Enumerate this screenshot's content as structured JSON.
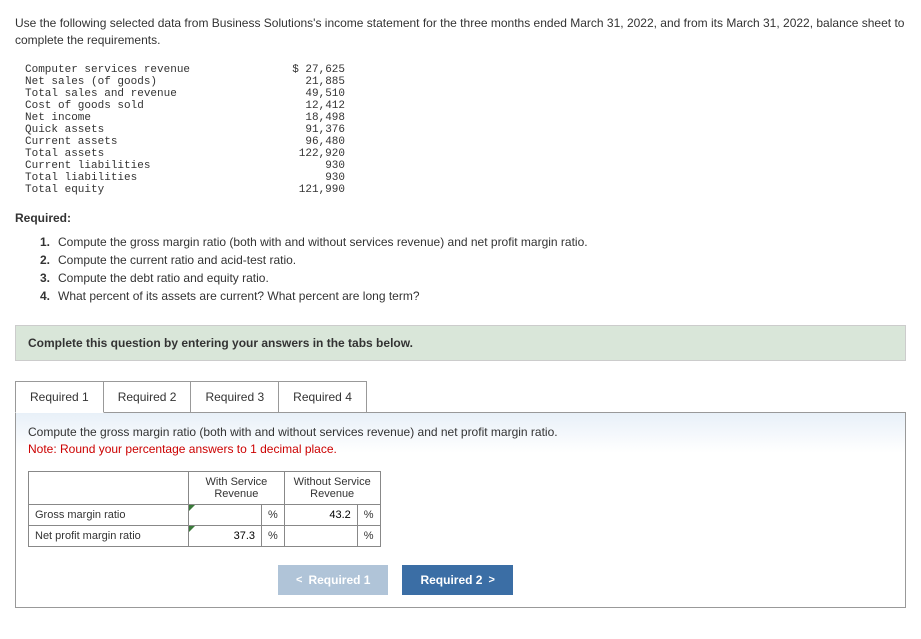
{
  "intro": "Use the following selected data from Business Solutions's income statement for the three months ended March 31, 2022, and from its March 31, 2022, balance sheet to complete the requirements.",
  "financials": [
    {
      "label": "Computer services revenue",
      "value": "$ 27,625"
    },
    {
      "label": "Net sales (of goods)",
      "value": "21,885"
    },
    {
      "label": "Total sales and revenue",
      "value": "49,510"
    },
    {
      "label": "Cost of goods sold",
      "value": "12,412"
    },
    {
      "label": "Net income",
      "value": "18,498"
    },
    {
      "label": "Quick assets",
      "value": "91,376"
    },
    {
      "label": "Current assets",
      "value": "96,480"
    },
    {
      "label": "Total assets",
      "value": "122,920"
    },
    {
      "label": "Current liabilities",
      "value": "930"
    },
    {
      "label": "Total liabilities",
      "value": "930"
    },
    {
      "label": "Total equity",
      "value": "121,990"
    }
  ],
  "required_heading": "Required:",
  "requirements": [
    {
      "num": "1.",
      "text": "Compute the gross margin ratio (both with and without services revenue) and net profit margin ratio."
    },
    {
      "num": "2.",
      "text": "Compute the current ratio and acid-test ratio."
    },
    {
      "num": "3.",
      "text": "Compute the debt ratio and equity ratio."
    },
    {
      "num": "4.",
      "text": "What percent of its assets are current? What percent are long term?"
    }
  ],
  "complete_bar": "Complete this question by entering your answers in the tabs below.",
  "tabs": [
    "Required 1",
    "Required 2",
    "Required 3",
    "Required 4"
  ],
  "panel": {
    "compute": "Compute the gross margin ratio (both with and without services revenue) and net profit margin ratio.",
    "note": "Note: Round your percentage answers to 1 decimal place.",
    "col1": "With Service Revenue",
    "col2": "Without Service Revenue",
    "row1": "Gross margin ratio",
    "row2": "Net profit margin ratio",
    "pct": "%",
    "val_r1c1": "",
    "val_r1c2": "43.2",
    "val_r2c1": "37.3",
    "val_r2c2": ""
  },
  "nav": {
    "prev": "Required 1",
    "next": "Required 2",
    "chev_left": "<",
    "chev_right": ">"
  }
}
